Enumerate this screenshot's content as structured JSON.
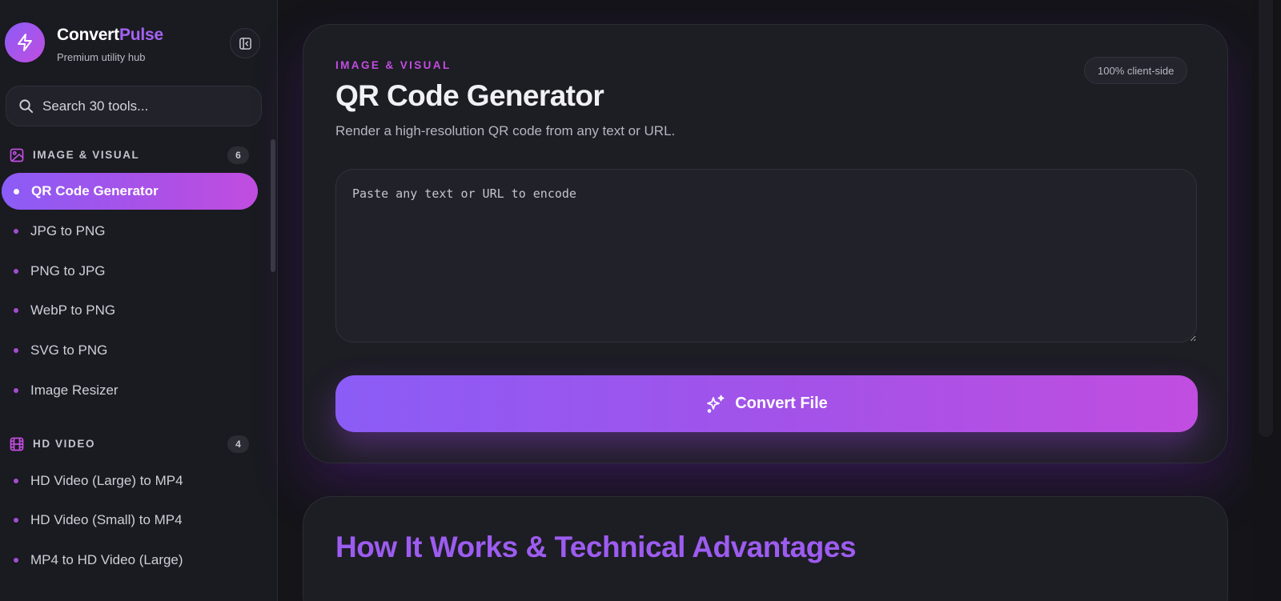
{
  "brand": {
    "name_primary": "Convert",
    "name_accent": "Pulse",
    "subtitle": "Premium utility hub",
    "logo_icon": "bolt-icon",
    "accent_color": "#a463f2"
  },
  "search": {
    "placeholder": "Search 30 tools..."
  },
  "sidebar": {
    "sections": [
      {
        "title": "IMAGE & VISUAL",
        "icon": "image-icon",
        "count": "6",
        "items": [
          {
            "label": "QR Code Generator",
            "active": true
          },
          {
            "label": "JPG to PNG"
          },
          {
            "label": "PNG to JPG"
          },
          {
            "label": "WebP to PNG"
          },
          {
            "label": "SVG to PNG"
          },
          {
            "label": "Image Resizer"
          }
        ]
      },
      {
        "title": "HD VIDEO",
        "icon": "film-icon",
        "count": "4",
        "items": [
          {
            "label": "HD Video (Large) to MP4"
          },
          {
            "label": "HD Video (Small) to MP4"
          },
          {
            "label": "MP4 to HD Video (Large)"
          }
        ]
      }
    ]
  },
  "tool": {
    "eyebrow": "IMAGE & VISUAL",
    "badge": "100% client-side",
    "title": "QR Code Generator",
    "description": "Render a high-resolution QR code from any text or URL.",
    "input_placeholder": "Paste any text or URL to encode",
    "input_value": "",
    "convert_label": "Convert File",
    "convert_icon": "sparkles-icon"
  },
  "info": {
    "title": "How It Works & Technical Advantages"
  },
  "colors": {
    "gradient_start": "#8b5cf6",
    "gradient_end": "#c14ee0",
    "eyebrow": "#c14ee0",
    "background": "#141419"
  }
}
